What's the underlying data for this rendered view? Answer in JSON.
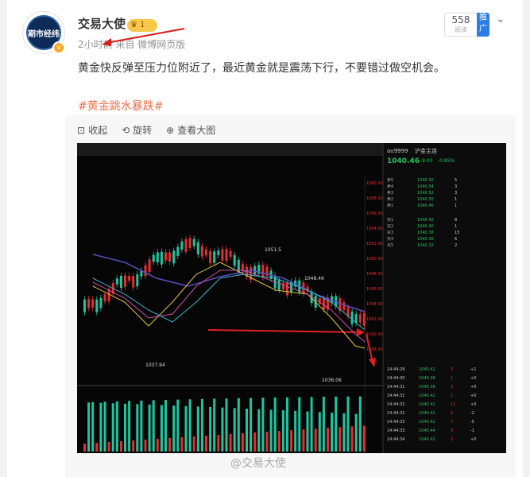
{
  "author": {
    "name": "交易大使",
    "avatar_text": "期市经纬",
    "level": "1"
  },
  "post_meta": {
    "time": "2小时前",
    "source": "来自 微博网页版"
  },
  "stats": {
    "read_count": "558",
    "read_label": "阅读",
    "promo": "推广"
  },
  "content": {
    "text": "黄金快反弹至压力位附近了，最近黄金就是震荡下行，不要错过做空机会。",
    "hashtag": "#黄金跳水暴跌#"
  },
  "toolbar": {
    "collapse": "收起",
    "rotate": "旋转",
    "view_large": "查看大图"
  },
  "watermark": "@交易大使",
  "chart_header": {
    "symbol": "au9999",
    "name": "沪金主连",
    "price": "1040.46",
    "change": "-9.00",
    "pct": "-0.85%"
  },
  "chart_labels": {
    "high": "1051.5",
    "low": "1037.94",
    "mid": "1048.46",
    "low2": "1036.06"
  },
  "order_book": {
    "asks": [
      {
        "l": "卖5",
        "p": "1040.56",
        "v": "5"
      },
      {
        "l": "卖4",
        "p": "1040.54",
        "v": "3"
      },
      {
        "l": "卖3",
        "p": "1040.52",
        "v": "3"
      },
      {
        "l": "卖2",
        "p": "1040.50",
        "v": "1"
      },
      {
        "l": "卖1",
        "p": "1040.46",
        "v": "1"
      }
    ],
    "bids": [
      {
        "l": "买1",
        "p": "1040.42",
        "v": "8"
      },
      {
        "l": "买2",
        "p": "1040.40",
        "v": "1"
      },
      {
        "l": "买3",
        "p": "1040.38",
        "v": "15"
      },
      {
        "l": "买4",
        "p": "1040.36",
        "v": "6"
      },
      {
        "l": "买5",
        "p": "1040.32",
        "v": "2"
      }
    ]
  },
  "axis_prices": [
    "1060.00",
    "1058.00",
    "1056.00",
    "1054.00",
    "1052.00",
    "1050.00",
    "1048.00",
    "1046.00",
    "1044.00",
    "1042.00",
    "1040.00",
    "1038.00"
  ],
  "ticks": [
    {
      "t": "14:44:29",
      "p": "1040.42",
      "v": "2",
      "o": "+1"
    },
    {
      "t": "14:44:30",
      "p": "1040.38",
      "v": "1",
      "o": "+0"
    },
    {
      "t": "14:44:31",
      "p": "1040.38",
      "v": "2",
      "o": "+0"
    },
    {
      "t": "14:44:31",
      "p": "1040.42",
      "v": "1",
      "o": "+0"
    },
    {
      "t": "14:44:32",
      "p": "1040.42",
      "v": "11",
      "o": "+0"
    },
    {
      "t": "14:44:32",
      "p": "1040.42",
      "v": "5",
      "o": "-2"
    },
    {
      "t": "14:44:33",
      "p": "1040.42",
      "v": "7",
      "o": "-5"
    },
    {
      "t": "14:44:33",
      "p": "1040.44",
      "v": "3",
      "o": "-1"
    },
    {
      "t": "14:44:34",
      "p": "1040.42",
      "v": "2",
      "o": "+0"
    }
  ]
}
